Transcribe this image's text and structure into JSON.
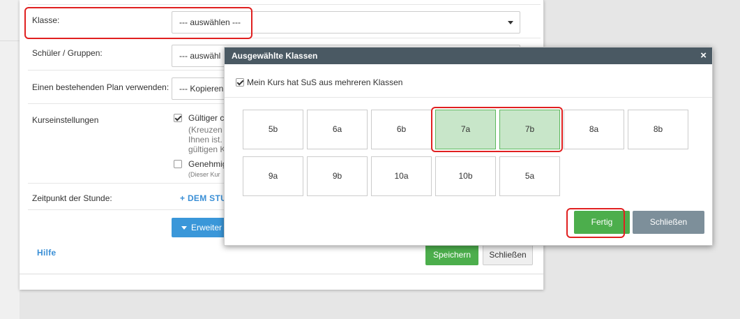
{
  "form": {
    "klasse_label": "Klasse:",
    "klasse_select": "--- auswählen ---",
    "schueler_label": "Schüler / Gruppen:",
    "schueler_select": "--- auswähl",
    "plan_label": "Einen bestehenden Plan verwenden:",
    "plan_select": "--- Kopieren",
    "kurs_label": "Kurseinstellungen",
    "gueltig_label": "Gültiger c",
    "gueltig_note_1": "(Kreuzen",
    "gueltig_note_2": "Ihnen ist.",
    "gueltig_note_3": "gültigen K",
    "genehmig_label": "Genehmig",
    "genehmig_note": "(Dieser Kur",
    "zeitpunkt_label": "Zeitpunkt der Stunde:",
    "zeitpunkt_link": "+ DEM STU",
    "erweitert_label": "Erweiter",
    "hilfe_link": "Hilfe",
    "save_button": "Speichern",
    "close_button": "Schließen"
  },
  "modal": {
    "title": "Ausgewählte Klassen",
    "close_icon": "×",
    "checkbox_label": "Mein Kurs hat SuS aus mehreren Klassen",
    "checkbox_checked": true,
    "classes_row1": [
      {
        "label": "5b",
        "selected": false
      },
      {
        "label": "6a",
        "selected": false
      },
      {
        "label": "6b",
        "selected": false
      },
      {
        "label": "7a",
        "selected": true
      },
      {
        "label": "7b",
        "selected": true
      },
      {
        "label": "8a",
        "selected": false
      },
      {
        "label": "8b",
        "selected": false
      }
    ],
    "classes_row2": [
      {
        "label": "9a",
        "selected": false
      },
      {
        "label": "9b",
        "selected": false
      },
      {
        "label": "10a",
        "selected": false
      },
      {
        "label": "10b",
        "selected": false
      },
      {
        "label": "5a",
        "selected": false
      }
    ],
    "done_button": "Fertig",
    "close_button": "Schließen"
  },
  "colors": {
    "header_bg": "#4a5963",
    "selected_tile": "#c8e6c9",
    "primary_green": "#4cae4c",
    "secondary_gray": "#7d8f9a",
    "accent_blue": "#3a97d9",
    "annotation_red": "#e02020"
  }
}
